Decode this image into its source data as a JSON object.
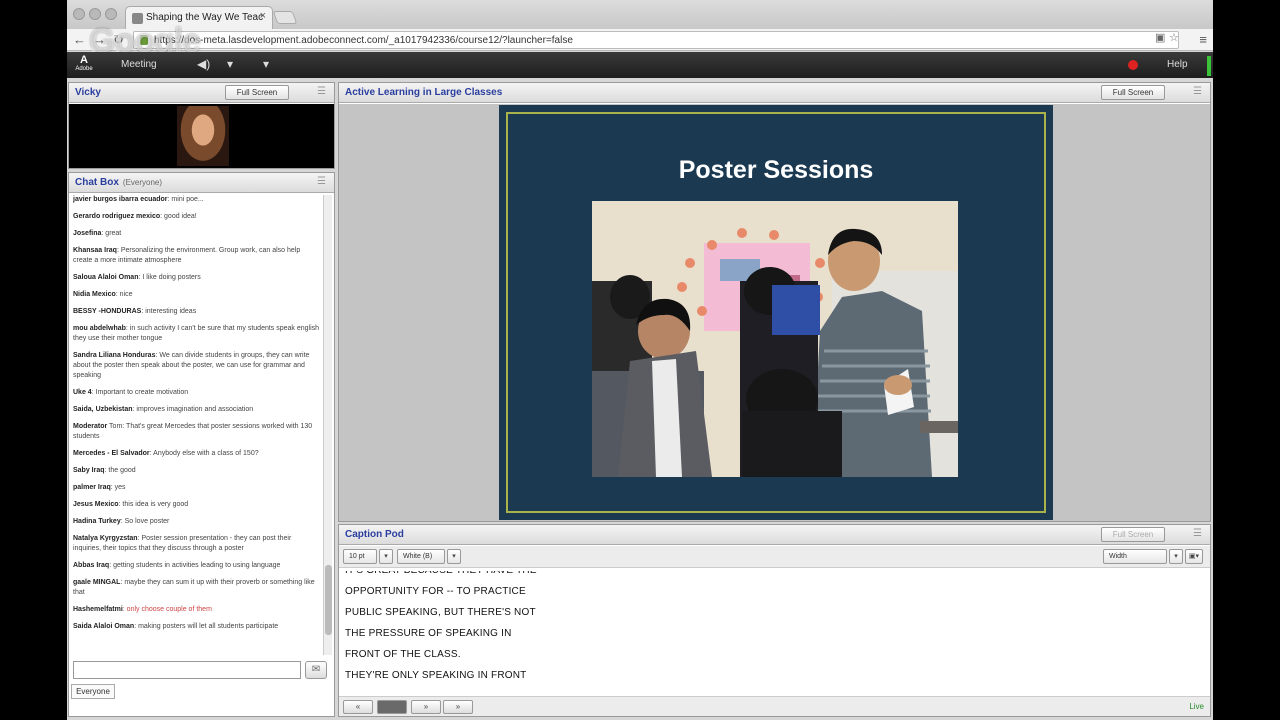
{
  "browser": {
    "tab_title": "Shaping the Way We Teac",
    "tab_close": "×",
    "url": "https://dos-meta.lasdevelopment.adobeconnect.com/_a1017942336/course12/?launcher=false",
    "watermark": "Google"
  },
  "menubar": {
    "logo": "A",
    "logo_caption": "Adobe",
    "meeting": "Meeting",
    "help": "Help"
  },
  "video_pod": {
    "title": "Vicky",
    "full_screen": "Full Screen"
  },
  "chat_pod": {
    "title": "Chat Box",
    "scope": "(Everyone)",
    "everyone_tab": "Everyone",
    "messages": [
      {
        "name": "javier burgos ibarra ecuador",
        "text": ": mini poe..."
      },
      {
        "name": "Gerardo rodriguez mexico",
        "text": ": good idea!"
      },
      {
        "name": "Josefina",
        "text": ": great"
      },
      {
        "name": "Khansaa Iraq",
        "text": ": Personalizing the environment. Group work, can also help create a more intimate atmosphere"
      },
      {
        "name": "Saloua Alaloi Oman",
        "text": ": I like doing posters"
      },
      {
        "name": "Nidia Mexico",
        "text": ": nice"
      },
      {
        "name": "BESSY -HONDURAS",
        "text": ": interesting ideas"
      },
      {
        "name": "mou abdelwhab",
        "text": ": in such activity I can't be sure that my students speak english they use their mother tongue"
      },
      {
        "name": "Sandra Liliana Honduras",
        "text": ": We can divide students in groups, they can write about the poster then speak about the poster, we can use for grammar and speaking"
      },
      {
        "name": "Uke 4",
        "text": ": Important to create motivation"
      },
      {
        "name": "Saida, Uzbekistan",
        "text": ": improves imagination and association"
      },
      {
        "name": "Moderator",
        "text": " Tom: That's great Mercedes that poster sessions worked with 130 students"
      },
      {
        "name": "Mercedes - El Salvador",
        "text": ": Anybody else with a class of 150?"
      },
      {
        "name": "Saby Iraq",
        "text": ": the good"
      },
      {
        "name": "palmer Iraq",
        "text": ": yes"
      },
      {
        "name": "Jesus Mexico",
        "text": ": this idea is very good"
      },
      {
        "name": "Hadina Turkey",
        "text": ": So love poster"
      },
      {
        "name": "Natalya Kyrgyzstan",
        "text": ": Poster session presentation - they can post their inquiries, their topics that they discuss through a poster"
      },
      {
        "name": "Abbas Iraq",
        "text": ": getting students in activities leading to using language"
      },
      {
        "name": "gaale MINGAL",
        "text": ": maybe they can sum it up with their proverb or something like that"
      },
      {
        "name": "Hashemelfatmi",
        "text": ": only choose couple of them",
        "red": true
      },
      {
        "name": "Saida Alaloi Oman",
        "text": ": making posters will let all students participate"
      }
    ]
  },
  "share_pod": {
    "title": "Active Learning in Large Classes",
    "full_screen": "Full Screen",
    "slide_title": "Poster Sessions"
  },
  "caption_pod": {
    "title": "Caption Pod",
    "full_screen": "Full Screen",
    "font_size": "10 pt",
    "color": "White (B)",
    "width": "Width",
    "lines": [
      "IT'S GREAT BECAUSE THEY HAVE THE",
      "OPPORTUNITY FOR -- TO PRACTICE",
      "PUBLIC SPEAKING, BUT THERE'S NOT",
      "THE PRESSURE OF SPEAKING IN",
      "FRONT OF THE CLASS.",
      "THEY'RE ONLY SPEAKING IN FRONT"
    ],
    "pager": [
      "«",
      "",
      "»",
      "»"
    ],
    "live": "Live"
  },
  "colors": {
    "pod_title": "#2a3e9e",
    "slide_bg": "#1b3a52",
    "slide_border": "#a9b34a",
    "record": "#dd2222"
  }
}
